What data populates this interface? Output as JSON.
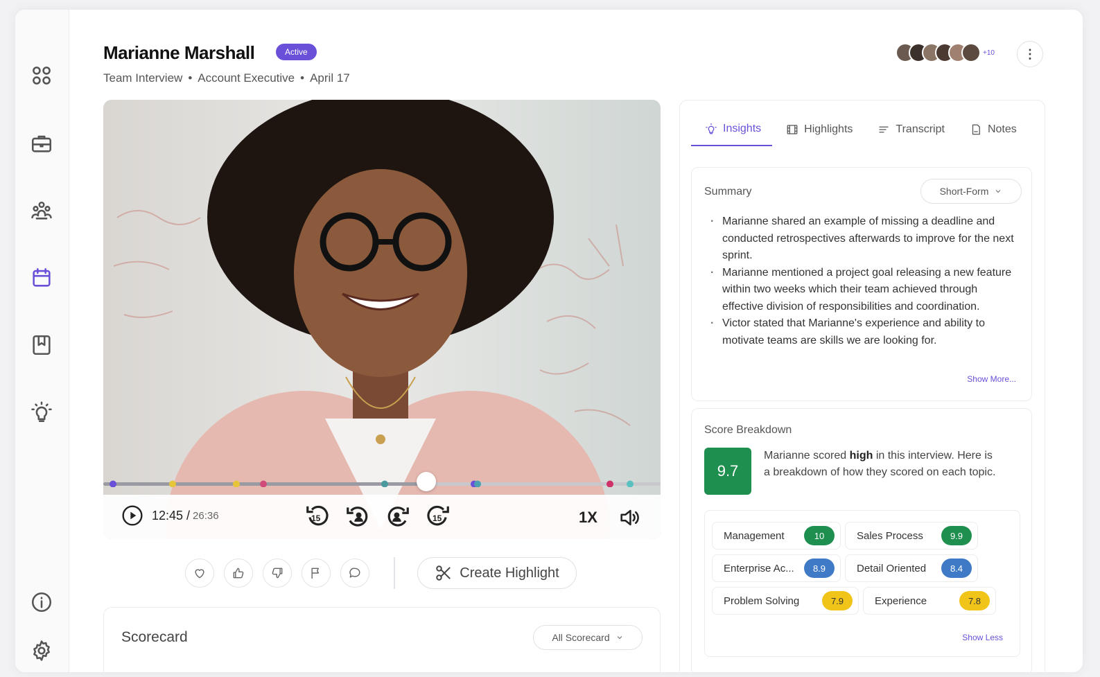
{
  "candidate": {
    "name": "Marianne Marshall",
    "status": "Active",
    "interview_type": "Team Interview",
    "role": "Account Executive",
    "date": "April 17",
    "separator": "•"
  },
  "participants": {
    "extra_count": "+10"
  },
  "colors": {
    "accent": "#6a4fd8",
    "score_green": "#1f8f4f",
    "score_blue": "#3f7ac6",
    "score_yellow": "#f0c419"
  },
  "sidebar": {
    "items": [
      {
        "icon": "grid-icon"
      },
      {
        "icon": "briefcase-icon"
      },
      {
        "icon": "team-icon"
      },
      {
        "icon": "calendar-icon",
        "active": true
      },
      {
        "icon": "book-icon"
      },
      {
        "icon": "lightbulb-icon"
      },
      {
        "icon": "info-icon"
      },
      {
        "icon": "gear-icon"
      }
    ]
  },
  "player": {
    "current_time": "12:45 /",
    "duration": "26:36",
    "speed": "1X",
    "skip_back_seconds": "15",
    "skip_forward_seconds": "15",
    "progress": 0.58
  },
  "actions": {
    "create_highlight": "Create Highlight"
  },
  "scorecard": {
    "title": "Scorecard",
    "filter": "All Scorecard"
  },
  "panel": {
    "tabs": [
      {
        "label": "Insights",
        "icon": "lightbulb-icon",
        "active": true
      },
      {
        "label": "Highlights",
        "icon": "film-icon"
      },
      {
        "label": "Transcript",
        "icon": "lines-icon"
      },
      {
        "label": "Notes",
        "icon": "note-icon"
      }
    ],
    "summary": {
      "title": "Summary",
      "format": "Short-Form",
      "bullets": [
        "Marianne shared an example of missing a deadline and conducted retrospectives afterwards to improve for the next sprint.",
        "Marianne mentioned a project goal releasing a new feature within two weeks which their team achieved through effective division of responsibilities and coordination.",
        "Victor stated that Marianne's experience and ability to motivate teams are skills we are looking for."
      ],
      "show_more": "Show More..."
    },
    "score_breakdown": {
      "title": "Score Breakdown",
      "overall": "9.7",
      "text_before": "Marianne scored ",
      "text_bold": "high",
      "text_after": " in this interview. Here is a breakdown of how they scored on each topic.",
      "topics": [
        {
          "name": "Management",
          "score": "10",
          "level": "green"
        },
        {
          "name": "Sales Process",
          "score": "9.9",
          "level": "green"
        },
        {
          "name": "Enterprise Ac...",
          "score": "8.9",
          "level": "blue"
        },
        {
          "name": "Detail Oriented",
          "score": "8.4",
          "level": "blue"
        },
        {
          "name": "Problem Solving",
          "score": "7.9",
          "level": "yellow"
        },
        {
          "name": "Experience",
          "score": "7.8",
          "level": "yellow"
        }
      ],
      "show_less": "Show Less"
    }
  }
}
